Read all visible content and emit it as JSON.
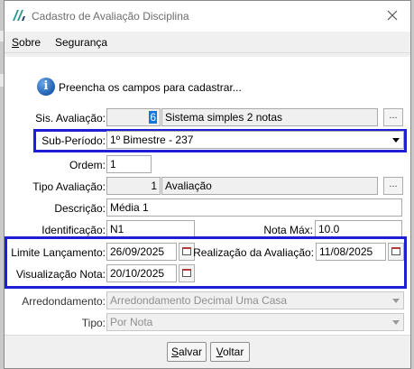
{
  "window": {
    "title": "Cadastro de Avaliação Disciplina"
  },
  "menu": {
    "items": [
      {
        "first": "S",
        "rest": "obre"
      },
      {
        "first": "",
        "rest": "Segurança"
      }
    ]
  },
  "info": {
    "message": "Preencha os campos para cadastrar..."
  },
  "form": {
    "sis_avaliacao": {
      "label": "Sis. Avaliação:",
      "code": "6",
      "description": "Sistema simples 2 notas",
      "button": "..."
    },
    "sub_periodo": {
      "label": "Sub-Período:",
      "value": "1º Bimestre - 237"
    },
    "ordem": {
      "label": "Ordem:",
      "value": "1"
    },
    "tipo_avaliacao": {
      "label": "Tipo Avaliação:",
      "code": "1",
      "description": "Avaliação",
      "button": "..."
    },
    "descricao": {
      "label": "Descrição:",
      "value": "Média 1"
    },
    "identificacao": {
      "label": "Identificação:",
      "value": "N1"
    },
    "nota_max": {
      "label": "Nota Máx:",
      "value": "10.0"
    },
    "limite_lancamento": {
      "label": "Limite Lançamento:",
      "value": "26/09/2025"
    },
    "realizacao_avaliacao": {
      "label": "Realização da Avaliação:",
      "value": "11/08/2025"
    },
    "visualizacao_nota": {
      "label": "Visualização Nota:",
      "value": "20/10/2025"
    },
    "arredondamento": {
      "label": "Arredondamento:",
      "value": "Arredondamento Decimal Uma Casa"
    },
    "tipo": {
      "label": "Tipo:",
      "value": "Por Nota"
    }
  },
  "footer": {
    "salvar": {
      "first": "S",
      "rest": "alvar"
    },
    "voltar": {
      "first": "V",
      "rest": "oltar"
    }
  },
  "colors": {
    "highlight_box": "#1e1ed2",
    "info_icon": "#1f5fb0",
    "selection": "#1874d8"
  }
}
